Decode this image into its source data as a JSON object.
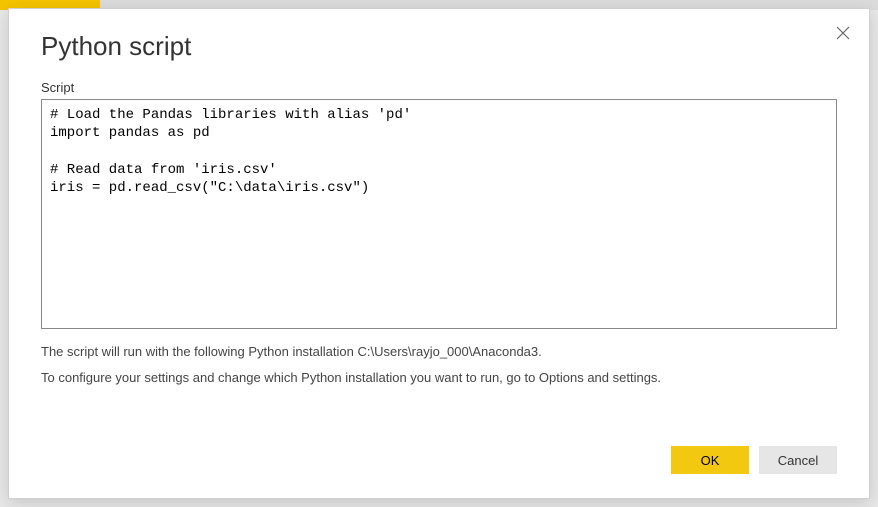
{
  "dialog": {
    "title": "Python script",
    "close_label": "Close"
  },
  "script": {
    "label": "Script",
    "content": "# Load the Pandas libraries with alias 'pd'\nimport pandas as pd\n\n# Read data from 'iris.csv'\niris = pd.read_csv(\"C:\\data\\iris.csv\")"
  },
  "info": {
    "line1": "The script will run with the following Python installation C:\\Users\\rayjo_000\\Anaconda3.",
    "line2": "To configure your settings and change which Python installation you want to run, go to Options and settings."
  },
  "buttons": {
    "ok": "OK",
    "cancel": "Cancel"
  }
}
